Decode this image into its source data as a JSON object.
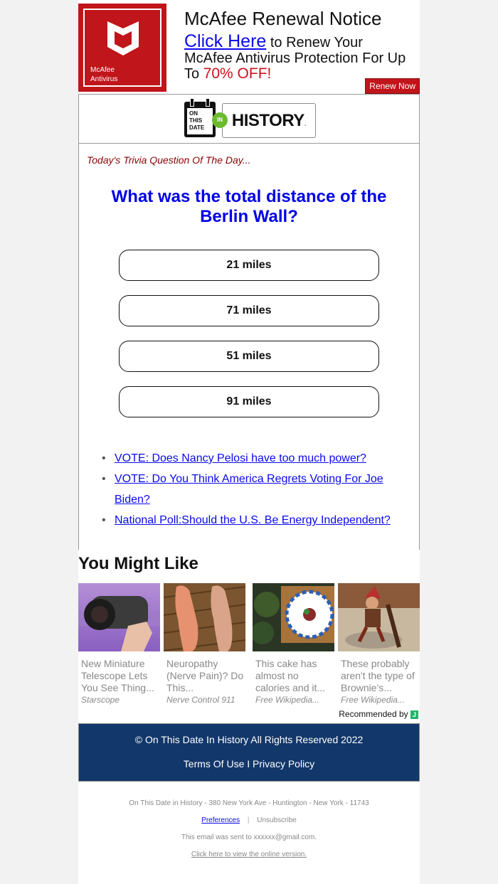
{
  "ad": {
    "logo_text_line1": "McAfee",
    "logo_text_line2": "Antivirus",
    "title": "McAfee Renewal Notice",
    "click_here": "Click Here",
    "body_1": " to Renew Your McAfee Antivirus Protection For Up To ",
    "discount": "70% OFF!",
    "renew_button": "Renew Now",
    "brand_color": "#c0151a"
  },
  "logo": {
    "cal_line1": "ON",
    "cal_line2": "THIS",
    "cal_line3": "DATE",
    "in": "IN",
    "history": "HISTORY",
    "dot": "."
  },
  "trivia": {
    "label": "Today's Trivia Question Of The Day...",
    "question": "What was the total distance of the Berlin Wall?",
    "answers": [
      "21 miles",
      "71 miles",
      "51 miles",
      "91 miles"
    ]
  },
  "links": [
    "VOTE: Does Nancy Pelosi have too much power?",
    "VOTE: Do You Think America Regrets Voting For Joe Biden?",
    "National Poll:Should the U.S. Be Energy Independent?"
  ],
  "recommendations": {
    "title": "You Might Like",
    "items": [
      {
        "text": "New Miniature Telescope Lets You See Thing...",
        "source": "Starscope",
        "image": "telescope-image"
      },
      {
        "text": "Neuropathy (Nerve Pain)? Do This...",
        "source": "Nerve Control 911",
        "image": "feet-image"
      },
      {
        "text": "This cake has almost no calories and it...",
        "source": "Free Wikipedia...",
        "image": "cake-plate-image"
      },
      {
        "text": "These probably aren't the type of Brownie's...",
        "source": "Free Wikipedia...",
        "image": "brownie-illustration-image"
      }
    ],
    "recommended_by": "Recommended by",
    "badge": "J"
  },
  "footer": {
    "copyright": "© On This Date In History All Rights Reserved 2022",
    "terms": "Terms Of Use",
    "separator": " I ",
    "privacy": "Privacy Policy",
    "bg_color": "#12376a"
  },
  "email_footer": {
    "address": "On This Date in History - 380 New York Ave - Huntington - New York - 11743",
    "preferences": "Preferences",
    "pipe": "|",
    "unsubscribe": "Unsubscribe",
    "sent_to": "This email was sent to xxxxxx@gmail.com.",
    "online_version": "Click here to view the online version."
  }
}
